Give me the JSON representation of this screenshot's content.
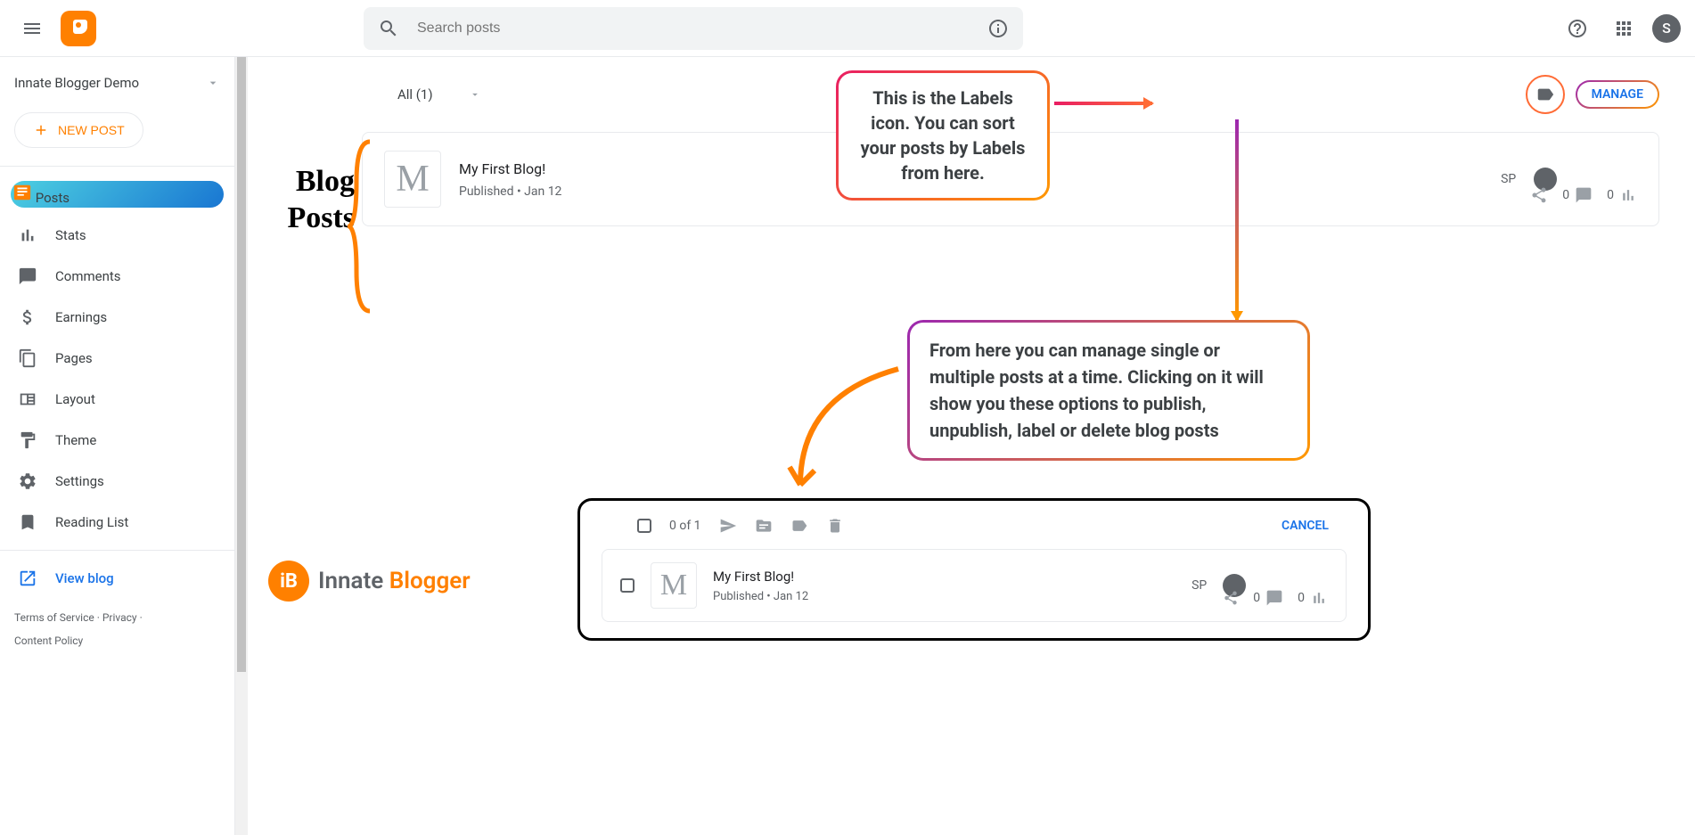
{
  "header": {
    "search_placeholder": "Search posts",
    "avatar_letter": "S"
  },
  "sidebar": {
    "blog_name": "Innate Blogger Demo",
    "new_post_label": "NEW POST",
    "items": [
      {
        "label": "Posts"
      },
      {
        "label": "Stats"
      },
      {
        "label": "Comments"
      },
      {
        "label": "Earnings"
      },
      {
        "label": "Pages"
      },
      {
        "label": "Layout"
      },
      {
        "label": "Theme"
      },
      {
        "label": "Settings"
      },
      {
        "label": "Reading List"
      }
    ],
    "view_blog_label": "View blog",
    "footer": {
      "terms": "Terms of Service",
      "privacy": "Privacy",
      "content_policy": "Content Policy"
    }
  },
  "main": {
    "filter_label": "All (1)",
    "manage_label": "MANAGE",
    "post": {
      "thumb_letter": "M",
      "title": "My First Blog!",
      "meta": "Published • Jan 12",
      "author": "SP",
      "comments": "0",
      "views": "0"
    }
  },
  "annotations": {
    "blog_posts_label_l1": "Blog",
    "blog_posts_label_l2": "Posts",
    "callout1": "This is the Labels icon. You can sort your posts by Labels from here.",
    "callout2": "From here you can manage single or multiple posts at a time. Clicking on it will show you these options to publish, unpublish, label or delete  blog posts",
    "innate_brand_1": "Innate ",
    "innate_brand_2": "Blogger",
    "innate_icon_text": "iB"
  },
  "manage_panel": {
    "selection_text": "0 of 1",
    "cancel_label": "CANCEL",
    "post": {
      "thumb_letter": "M",
      "title": "My First Blog!",
      "meta": "Published • Jan 12",
      "author": "SP",
      "comments": "0",
      "views": "0"
    }
  }
}
